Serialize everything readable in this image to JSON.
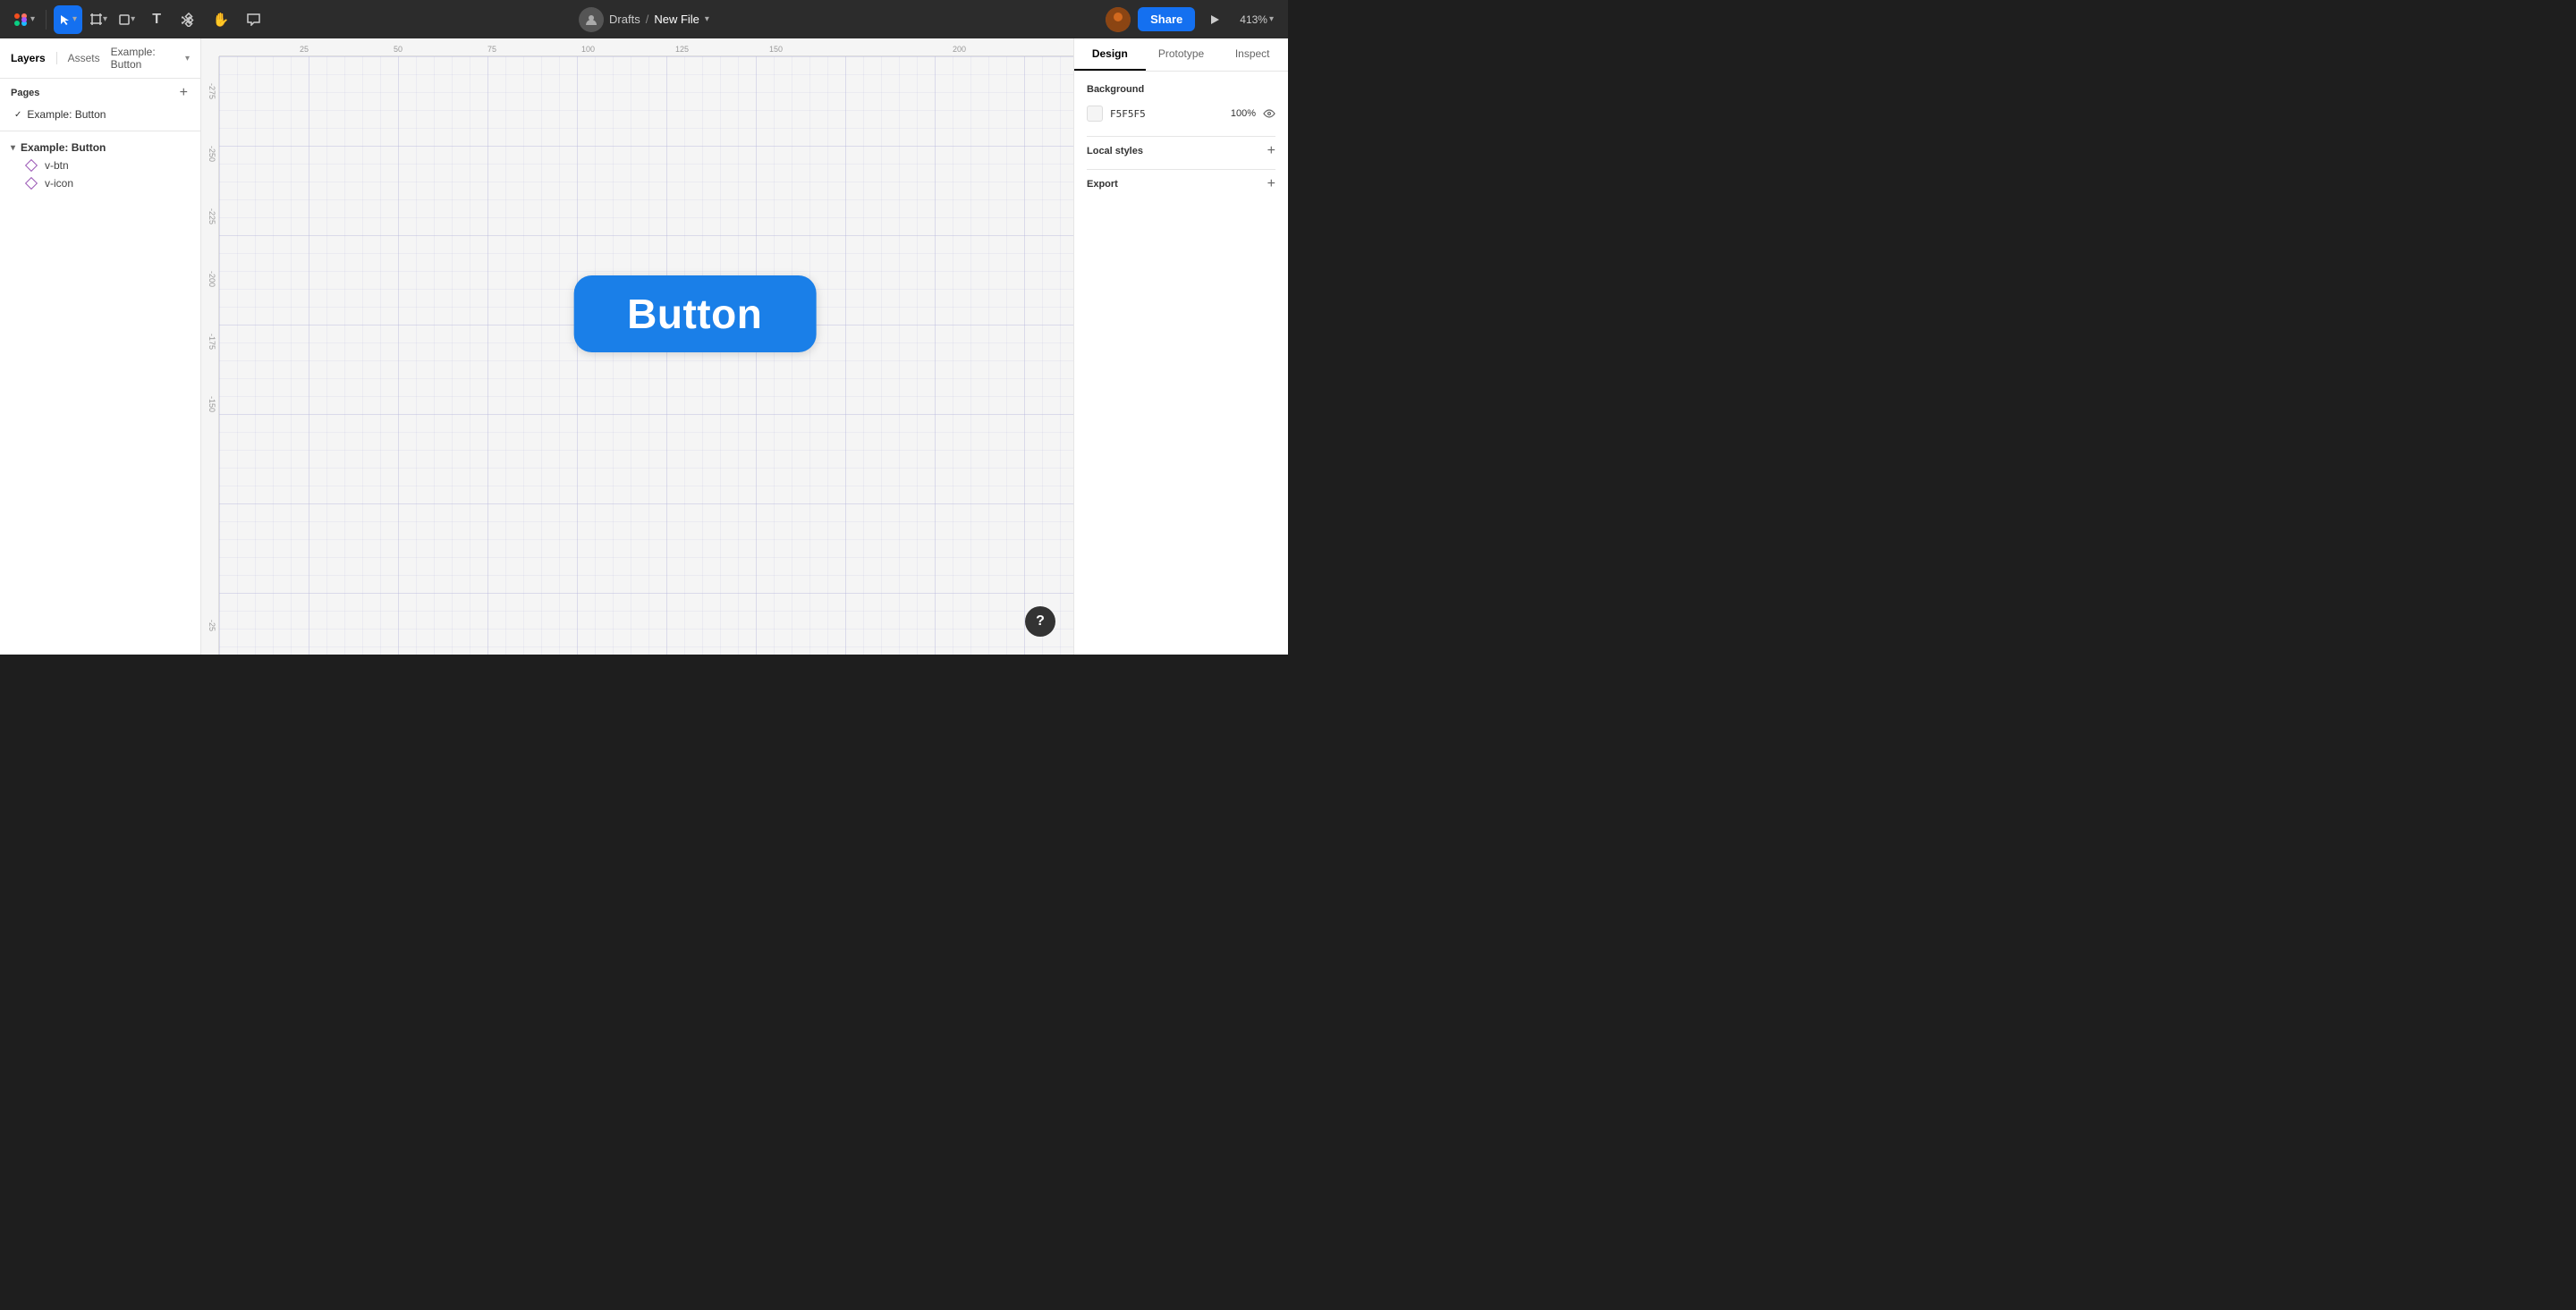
{
  "app": {
    "title": "New File",
    "breadcrumb_separator": "/",
    "breadcrumb_parent": "Drafts"
  },
  "toolbar": {
    "tools": [
      {
        "id": "select",
        "label": "▶",
        "active": true
      },
      {
        "id": "frame",
        "label": "⬜"
      },
      {
        "id": "shape",
        "label": "◇"
      },
      {
        "id": "text",
        "label": "T"
      },
      {
        "id": "component",
        "label": "❖"
      },
      {
        "id": "hand",
        "label": "✋"
      },
      {
        "id": "comment",
        "label": "💬"
      }
    ],
    "share_label": "Share",
    "zoom_label": "413%",
    "play_label": "▶"
  },
  "left_panel": {
    "tabs": [
      {
        "id": "layers",
        "label": "Layers",
        "active": true
      },
      {
        "id": "assets",
        "label": "Assets"
      }
    ],
    "breadcrumb": "Example: Button",
    "pages_title": "Pages",
    "add_page_label": "+",
    "pages": [
      {
        "id": "example-button",
        "label": "Example: Button",
        "active": true
      }
    ],
    "layers": [
      {
        "id": "v-btn",
        "label": "v-btn",
        "type": "component",
        "depth": 1
      },
      {
        "id": "v-icon",
        "label": "v-icon",
        "type": "component",
        "depth": 1
      }
    ]
  },
  "canvas": {
    "button_text": "Button",
    "button_color": "#1a7fe8",
    "background_color": "#f5f5f5",
    "ruler_marks_h": [
      "25",
      "50",
      "75",
      "100",
      "125",
      "150",
      "200"
    ],
    "ruler_marks_v": [
      "-275",
      "-250",
      "-225",
      "-200",
      "-175",
      "-150",
      "-25"
    ]
  },
  "right_panel": {
    "tabs": [
      {
        "id": "design",
        "label": "Design",
        "active": true
      },
      {
        "id": "prototype",
        "label": "Prototype"
      },
      {
        "id": "inspect",
        "label": "Inspect"
      }
    ],
    "background_label": "Background",
    "bg_color_hex": "F5F5F5",
    "bg_color_opacity": "100%",
    "local_styles_label": "Local styles",
    "export_label": "Export",
    "add_label": "+",
    "help_label": "?"
  }
}
